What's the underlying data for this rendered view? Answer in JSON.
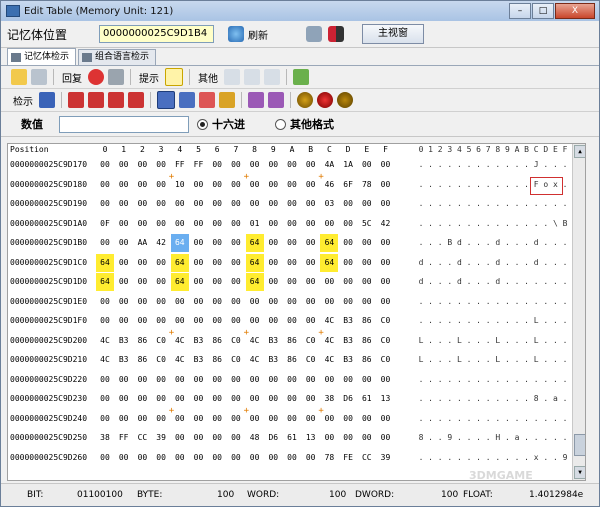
{
  "window": {
    "title": "Edit Table (Memory Unit: 121)",
    "btn_min": "–",
    "btn_max": "□",
    "btn_close": "X"
  },
  "addrbar": {
    "label": "记忆体位置",
    "address": "0000000025C9D1B4",
    "refresh": "刷新",
    "main_view": "主视窗"
  },
  "tabs": [
    {
      "label": "记忆体检示"
    },
    {
      "label": "组合语言检示"
    }
  ],
  "toolbar1": {
    "restore": "回复",
    "hint": "提示",
    "other": "其他"
  },
  "toolbar2": {
    "view": "检示"
  },
  "valuerow": {
    "label": "数值",
    "input_value": "",
    "radio_hex": "十六进",
    "radio_other": "其他格式"
  },
  "header": {
    "position": "Position",
    "hex_cols": [
      "0",
      "1",
      "2",
      "3",
      "4",
      "5",
      "6",
      "7",
      "8",
      "9",
      "A",
      "B",
      "C",
      "D",
      "E",
      "F"
    ],
    "ascii_cols": [
      "0",
      "1",
      "2",
      "3",
      "4",
      "5",
      "6",
      "7",
      "8",
      "9",
      "A",
      "B",
      "C",
      "D",
      "E",
      "F"
    ]
  },
  "rows": [
    {
      "addr": "0000000025C9D170",
      "bytes": [
        "00",
        "00",
        "00",
        "00",
        "FF",
        "FF",
        "00",
        "00",
        "00",
        "00",
        "00",
        "00",
        "4A",
        "1A",
        "00",
        "00"
      ],
      "ascii": [
        ".",
        ".",
        ".",
        ".",
        ".",
        ".",
        ".",
        ".",
        ".",
        ".",
        ".",
        ".",
        "J",
        ".",
        ".",
        "."
      ]
    },
    {
      "addr": "0000000025C9D180",
      "bytes": [
        "00",
        "00",
        "00",
        "00",
        "10",
        "00",
        "00",
        "00",
        "00",
        "00",
        "00",
        "00",
        "46",
        "6F",
        "78",
        "00"
      ],
      "ascii": [
        ".",
        ".",
        ".",
        ".",
        ".",
        ".",
        ".",
        ".",
        ".",
        ".",
        ".",
        ".",
        "F",
        "o",
        "x",
        "."
      ]
    },
    {
      "addr": "0000000025C9D190",
      "bytes": [
        "00",
        "00",
        "00",
        "00",
        "00",
        "00",
        "00",
        "00",
        "00",
        "00",
        "00",
        "00",
        "03",
        "00",
        "00",
        "00"
      ],
      "ascii": [
        ".",
        ".",
        ".",
        ".",
        ".",
        ".",
        ".",
        ".",
        ".",
        ".",
        ".",
        ".",
        ".",
        ".",
        ".",
        "."
      ]
    },
    {
      "addr": "0000000025C9D1A0",
      "bytes": [
        "0F",
        "00",
        "00",
        "00",
        "00",
        "00",
        "00",
        "00",
        "01",
        "00",
        "00",
        "00",
        "00",
        "00",
        "5C",
        "42"
      ],
      "ascii": [
        ".",
        ".",
        ".",
        ".",
        ".",
        ".",
        ".",
        ".",
        ".",
        ".",
        ".",
        ".",
        ".",
        ".",
        "\\",
        "B"
      ]
    },
    {
      "addr": "0000000025C9D1B0",
      "bytes": [
        "00",
        "00",
        "AA",
        "42",
        "64",
        "00",
        "00",
        "00",
        "64",
        "00",
        "00",
        "00",
        "64",
        "00",
        "00",
        "00"
      ],
      "ascii": [
        ".",
        ".",
        ".",
        "B",
        "d",
        ".",
        ".",
        ".",
        "d",
        ".",
        ".",
        ".",
        "d",
        ".",
        ".",
        "."
      ]
    },
    {
      "addr": "0000000025C9D1C0",
      "bytes": [
        "64",
        "00",
        "00",
        "00",
        "64",
        "00",
        "00",
        "00",
        "64",
        "00",
        "00",
        "00",
        "64",
        "00",
        "00",
        "00"
      ],
      "ascii": [
        "d",
        ".",
        ".",
        ".",
        "d",
        ".",
        ".",
        ".",
        "d",
        ".",
        ".",
        ".",
        "d",
        ".",
        ".",
        "."
      ]
    },
    {
      "addr": "0000000025C9D1D0",
      "bytes": [
        "64",
        "00",
        "00",
        "00",
        "64",
        "00",
        "00",
        "00",
        "64",
        "00",
        "00",
        "00",
        "00",
        "00",
        "00",
        "00"
      ],
      "ascii": [
        "d",
        ".",
        ".",
        ".",
        "d",
        ".",
        ".",
        ".",
        "d",
        ".",
        ".",
        ".",
        ".",
        ".",
        ".",
        "."
      ]
    },
    {
      "addr": "0000000025C9D1E0",
      "bytes": [
        "00",
        "00",
        "00",
        "00",
        "00",
        "00",
        "00",
        "00",
        "00",
        "00",
        "00",
        "00",
        "00",
        "00",
        "00",
        "00"
      ],
      "ascii": [
        ".",
        ".",
        ".",
        ".",
        ".",
        ".",
        ".",
        ".",
        ".",
        ".",
        ".",
        ".",
        ".",
        ".",
        ".",
        "."
      ]
    },
    {
      "addr": "0000000025C9D1F0",
      "bytes": [
        "00",
        "00",
        "00",
        "00",
        "00",
        "00",
        "00",
        "00",
        "00",
        "00",
        "00",
        "00",
        "4C",
        "B3",
        "86",
        "C0"
      ],
      "ascii": [
        ".",
        ".",
        ".",
        ".",
        ".",
        ".",
        ".",
        ".",
        ".",
        ".",
        ".",
        ".",
        "L",
        ".",
        ".",
        "."
      ]
    },
    {
      "addr": "0000000025C9D200",
      "bytes": [
        "4C",
        "B3",
        "86",
        "C0",
        "4C",
        "B3",
        "86",
        "C0",
        "4C",
        "B3",
        "86",
        "C0",
        "4C",
        "B3",
        "86",
        "C0"
      ],
      "ascii": [
        "L",
        ".",
        ".",
        ".",
        "L",
        ".",
        ".",
        ".",
        "L",
        ".",
        ".",
        ".",
        "L",
        ".",
        ".",
        "."
      ]
    },
    {
      "addr": "0000000025C9D210",
      "bytes": [
        "4C",
        "B3",
        "86",
        "C0",
        "4C",
        "B3",
        "86",
        "C0",
        "4C",
        "B3",
        "86",
        "C0",
        "4C",
        "B3",
        "86",
        "C0"
      ],
      "ascii": [
        "L",
        ".",
        ".",
        ".",
        "L",
        ".",
        ".",
        ".",
        "L",
        ".",
        ".",
        ".",
        "L",
        ".",
        ".",
        "."
      ]
    },
    {
      "addr": "0000000025C9D220",
      "bytes": [
        "00",
        "00",
        "00",
        "00",
        "00",
        "00",
        "00",
        "00",
        "00",
        "00",
        "00",
        "00",
        "00",
        "00",
        "00",
        "00"
      ],
      "ascii": [
        ".",
        ".",
        ".",
        ".",
        ".",
        ".",
        ".",
        ".",
        ".",
        ".",
        ".",
        ".",
        ".",
        ".",
        ".",
        "."
      ]
    },
    {
      "addr": "0000000025C9D230",
      "bytes": [
        "00",
        "00",
        "00",
        "00",
        "00",
        "00",
        "00",
        "00",
        "00",
        "00",
        "00",
        "00",
        "38",
        "D6",
        "61",
        "13"
      ],
      "ascii": [
        ".",
        ".",
        ".",
        ".",
        ".",
        ".",
        ".",
        ".",
        ".",
        ".",
        ".",
        ".",
        "8",
        ".",
        "a",
        "."
      ]
    },
    {
      "addr": "0000000025C9D240",
      "bytes": [
        "00",
        "00",
        "00",
        "00",
        "00",
        "00",
        "00",
        "00",
        "00",
        "00",
        "00",
        "00",
        "00",
        "00",
        "00",
        "00"
      ],
      "ascii": [
        ".",
        ".",
        ".",
        ".",
        ".",
        ".",
        ".",
        ".",
        ".",
        ".",
        ".",
        ".",
        ".",
        ".",
        ".",
        "."
      ]
    },
    {
      "addr": "0000000025C9D250",
      "bytes": [
        "38",
        "FF",
        "CC",
        "39",
        "00",
        "00",
        "00",
        "00",
        "48",
        "D6",
        "61",
        "13",
        "00",
        "00",
        "00",
        "00"
      ],
      "ascii": [
        "8",
        ".",
        ".",
        "9",
        ".",
        ".",
        ".",
        ".",
        "H",
        ".",
        "a",
        ".",
        ".",
        ".",
        ".",
        "."
      ]
    },
    {
      "addr": "0000000025C9D260",
      "bytes": [
        "00",
        "00",
        "00",
        "00",
        "00",
        "00",
        "00",
        "00",
        "00",
        "00",
        "00",
        "00",
        "78",
        "FE",
        "CC",
        "39"
      ],
      "ascii": [
        ".",
        ".",
        ".",
        ".",
        ".",
        ".",
        ".",
        ".",
        ".",
        ".",
        ".",
        ".",
        "x",
        ".",
        ".",
        "9"
      ]
    }
  ],
  "highlights": [
    "5.0",
    "6.0",
    "4.4",
    "5.4",
    "6.4",
    "4.8",
    "5.8",
    "6.8",
    "4.12",
    "5.12"
  ],
  "selected": "4.4",
  "status": {
    "bit_label": "BIT:",
    "bit_value": "01100100",
    "byte_label": "BYTE:",
    "byte_value": "100",
    "word_label": "WORD:",
    "word_value": "100",
    "dword_label": "DWORD:",
    "dword_value": "100",
    "float_label": "FLOAT:",
    "float_value": "1.4012984e"
  },
  "watermark": "3DMGAME",
  "colors": {
    "highlight": "#ffec30",
    "selected": "#6aaef0",
    "address_bg": "#ffffc8"
  }
}
